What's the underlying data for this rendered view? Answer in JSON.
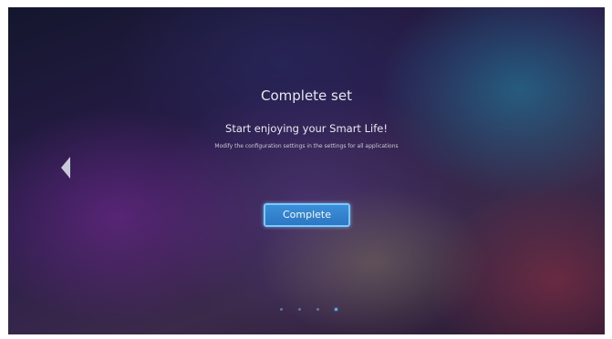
{
  "screen": {
    "title": "Complete set",
    "subtitle": "Start enjoying your Smart Life!",
    "hint": "Modify the configuration settings in the settings for all applications",
    "complete_button_label": "Complete",
    "nav_back_icon": "triangle-left-icon",
    "pager": {
      "count": 4,
      "active_index": 3
    }
  },
  "colors": {
    "button_bg": "#2c77c4",
    "button_border": "#7cc9ff",
    "dot_active": "#5fb4ff",
    "dot_inactive": "#5a79a8"
  }
}
